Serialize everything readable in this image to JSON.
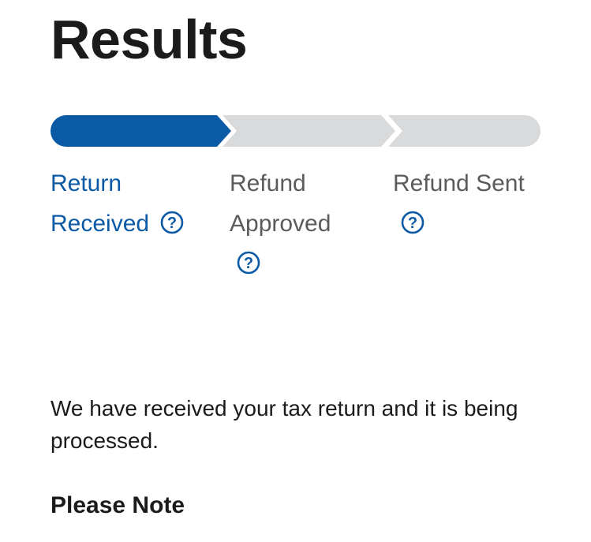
{
  "page": {
    "title": "Results"
  },
  "progress": {
    "completed_steps": 1,
    "total_steps": 3,
    "active_color": "#0b5aa6",
    "inactive_color": "#d9dadb"
  },
  "steps": [
    {
      "label_line1": "Return",
      "label_line2": "Received",
      "status": "completed",
      "help_icon": "question-circle-icon"
    },
    {
      "label_line1": "Refund",
      "label_line2": "Approved",
      "status": "pending",
      "help_icon": "question-circle-icon"
    },
    {
      "label_line1": "Refund Sent",
      "label_line2": "",
      "status": "pending",
      "help_icon": "question-circle-icon"
    }
  ],
  "message": {
    "text": "We have received your tax return and it is being processed."
  },
  "note": {
    "heading": "Please Note"
  }
}
